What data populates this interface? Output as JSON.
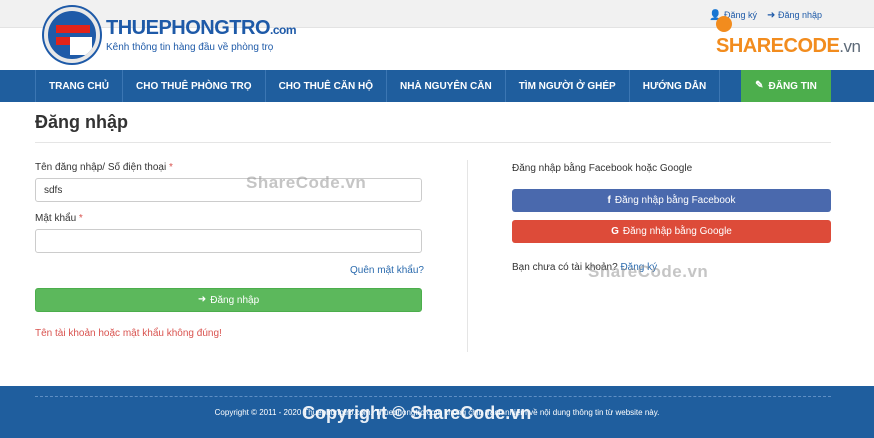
{
  "header": {
    "brand_name": "THUEPHONGTRO",
    "brand_suffix": ".com",
    "slogan": "Kênh thông tin hàng đầu về phòng trọ",
    "register_label": "Đăng ký",
    "login_label": "Đăng nhập"
  },
  "watermark": {
    "top_brand": "SHARECODE",
    "top_suffix": ".vn",
    "mid_text": "ShareCode.vn",
    "footer_text": "Copyright © ShareCode.vn"
  },
  "nav": {
    "items": [
      {
        "label": "Trang chủ"
      },
      {
        "label": "Cho thuê phòng trọ"
      },
      {
        "label": "Cho thuê căn hộ"
      },
      {
        "label": "Nhà nguyên căn"
      },
      {
        "label": "Tìm người ở ghép"
      },
      {
        "label": "Hướng dẫn"
      }
    ],
    "post_label": "ĐĂNG TIN"
  },
  "page": {
    "title": "Đăng nhập"
  },
  "form": {
    "username_label": "Tên đăng nhập/ Số điện thoại",
    "username_value": "sdfs",
    "password_label": "Mật khẩu",
    "password_value": "",
    "required_mark": "*",
    "forgot_label": "Quên mật khẩu?",
    "submit_label": "Đăng nhập",
    "error_message": "Tên tài khoản hoặc mật khẩu không đúng!"
  },
  "social": {
    "heading": "Đăng nhập bằng Facebook hoặc Google",
    "facebook_label": "Đăng nhập bằng Facebook",
    "google_label": "Đăng nhập bằng Google",
    "register_prompt": "Bạn chưa có tài khoản?",
    "register_link": "Đăng ký"
  },
  "footer": {
    "copyright": "Copyright © 2011 - 2020 Thuephongtro.com. Thuephongtro.com không chịu trách nhiệm về nội dung thông tin từ website này."
  },
  "colors": {
    "primary_blue": "#1f5e9e",
    "green": "#5cb85c",
    "facebook": "#4a69ad",
    "google": "#dd4b39",
    "error_red": "#d9534f"
  }
}
